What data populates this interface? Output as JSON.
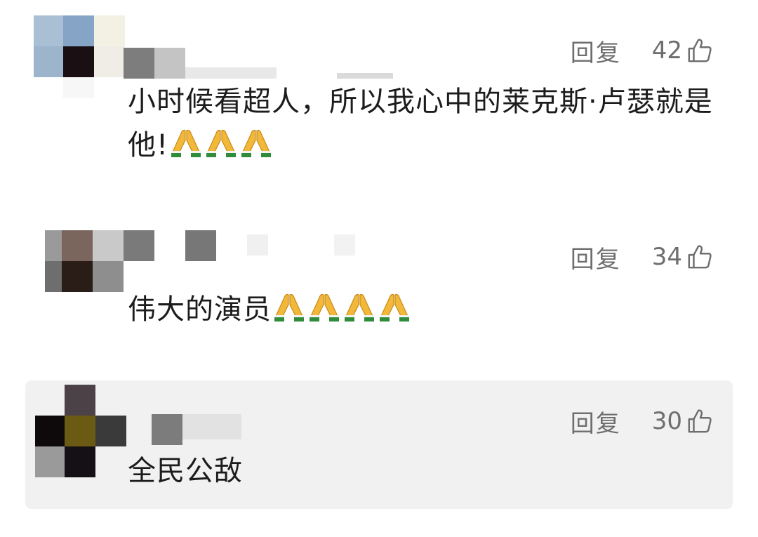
{
  "comments": [
    {
      "reply_label": "回复",
      "likes": "42",
      "text": "小时候看超人，所以我心中的莱克斯·卢瑟就是他!",
      "emoji": "folded-hands",
      "emoji_count": 3
    },
    {
      "reply_label": "回复",
      "likes": "34",
      "text": "伟大的演员",
      "emoji": "folded-hands",
      "emoji_count": 4
    },
    {
      "reply_label": "回复",
      "likes": "30",
      "text": "全民公敌",
      "emoji_count": 0
    }
  ],
  "icons": {
    "like": "thumbs-up-icon",
    "emoji": "folded-hands-icon"
  },
  "colors": {
    "text": "#1c1c1c",
    "meta": "#6e6e6e",
    "highlight_bg": "#f1f1f1"
  }
}
